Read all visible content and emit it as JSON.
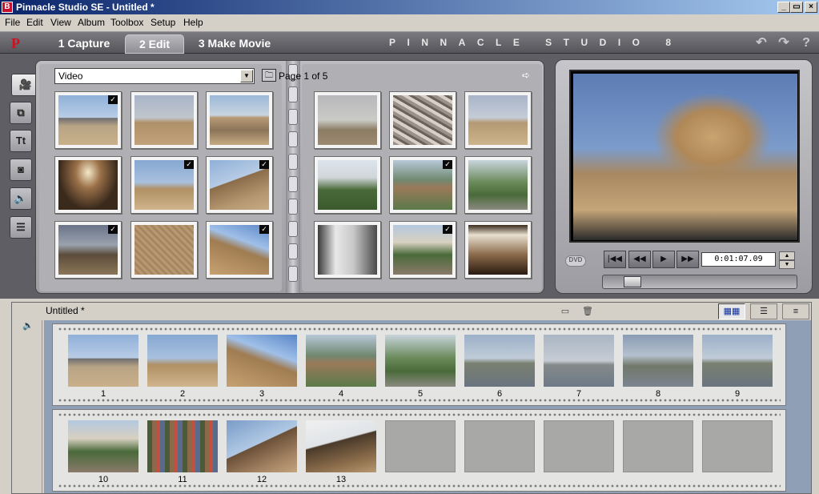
{
  "window": {
    "title": "Pinnacle Studio SE - Untitled *",
    "app_icon": "pinnacle-app-icon",
    "controls": {
      "minimize": "_",
      "maximize": "▭",
      "close": "×"
    }
  },
  "menu": [
    "File",
    "Edit",
    "View",
    "Album",
    "Toolbox",
    "Setup",
    "Help"
  ],
  "modebar": {
    "logo": "P",
    "tabs": [
      {
        "label": "1 Capture",
        "active": false
      },
      {
        "label": "2 Edit",
        "active": true
      },
      {
        "label": "3 Make Movie",
        "active": false
      }
    ],
    "brand": "PINNACLE STUDIO 8",
    "undo_icon": "undo-icon",
    "redo_icon": "redo-icon",
    "help_icon": "help-icon",
    "help_label": "?"
  },
  "album": {
    "tool_tabs": [
      {
        "name": "video-scenes-tab",
        "icon": "camcorder-icon",
        "glyph": "🎥",
        "active": true
      },
      {
        "name": "transitions-tab",
        "icon": "transition-icon",
        "glyph": "⧉",
        "active": false
      },
      {
        "name": "titles-tab",
        "icon": "title-icon",
        "glyph": "Tt",
        "active": false
      },
      {
        "name": "still-images-tab",
        "icon": "camera-icon",
        "glyph": "◙",
        "active": false
      },
      {
        "name": "sound-effects-tab",
        "icon": "speaker-icon",
        "glyph": "🔈",
        "active": false
      },
      {
        "name": "disc-menus-tab",
        "icon": "menu-icon",
        "glyph": "☰",
        "active": false
      }
    ],
    "source_select": {
      "value": "Video"
    },
    "page_label": "Page 1 of 5",
    "left_page": [
      {
        "image": "i-pyr1",
        "checked": true
      },
      {
        "image": "i-pyr2",
        "checked": false
      },
      {
        "image": "i-pyr3",
        "checked": false
      },
      {
        "image": "i-tomb",
        "checked": false
      },
      {
        "image": "i-sphinx",
        "checked": true
      },
      {
        "image": "i-pyrface",
        "checked": true
      },
      {
        "image": "i-dark",
        "checked": true
      },
      {
        "image": "i-stone",
        "checked": false
      },
      {
        "image": "i-pyrblue",
        "checked": true
      }
    ],
    "right_page": [
      {
        "image": "i-haze",
        "checked": false
      },
      {
        "image": "i-blur",
        "checked": false
      },
      {
        "image": "i-desert",
        "checked": false
      },
      {
        "image": "i-garden",
        "checked": false
      },
      {
        "image": "i-statue",
        "checked": true
      },
      {
        "image": "i-park",
        "checked": false
      },
      {
        "image": "i-column",
        "checked": false
      },
      {
        "image": "i-street",
        "checked": true
      },
      {
        "image": "i-indoor",
        "checked": false
      }
    ]
  },
  "player": {
    "dvd_label": "DVD",
    "buttons": [
      {
        "name": "go-to-start-button",
        "icon": "skip-back-icon",
        "glyph": "|◀◀"
      },
      {
        "name": "rewind-button",
        "icon": "rewind-icon",
        "glyph": "◀◀"
      },
      {
        "name": "play-button",
        "icon": "play-icon",
        "glyph": "▶"
      },
      {
        "name": "fast-forward-button",
        "icon": "fast-forward-icon",
        "glyph": "▶▶"
      }
    ],
    "timecode": "0:01:07.09",
    "scrub_position": 0.12
  },
  "movie": {
    "title": "Untitled *",
    "view_buttons": [
      {
        "name": "storyboard-view-button",
        "icon": "storyboard-icon",
        "glyph": "▦▦",
        "active": true
      },
      {
        "name": "timeline-view-button",
        "icon": "timeline-icon",
        "glyph": "☰",
        "active": false
      },
      {
        "name": "text-view-button",
        "icon": "list-icon",
        "glyph": "≡",
        "active": false
      }
    ],
    "storyboard_rows": [
      [
        {
          "num": "1",
          "image": "i-pyr1"
        },
        {
          "num": "2",
          "image": "i-sphinx"
        },
        {
          "num": "3",
          "image": "i-pyrblue"
        },
        {
          "num": "4",
          "image": "i-statue"
        },
        {
          "num": "5",
          "image": "i-park"
        },
        {
          "num": "6",
          "image": "i-city1"
        },
        {
          "num": "7",
          "image": "i-city2"
        },
        {
          "num": "8",
          "image": "i-city3"
        },
        {
          "num": "9",
          "image": "i-city1"
        }
      ],
      [
        {
          "num": "10",
          "image": "i-street"
        },
        {
          "num": "11",
          "image": "i-aerial"
        },
        {
          "num": "12",
          "image": "i-pyrbig"
        },
        {
          "num": "13",
          "image": "i-pyrwhite"
        },
        {
          "num": "",
          "image": ""
        },
        {
          "num": "",
          "image": ""
        },
        {
          "num": "",
          "image": ""
        },
        {
          "num": "",
          "image": ""
        },
        {
          "num": "",
          "image": ""
        }
      ]
    ]
  }
}
